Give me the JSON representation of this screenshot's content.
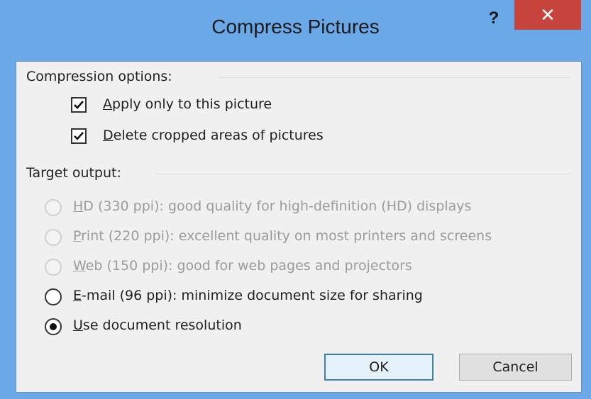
{
  "window": {
    "title": "Compress Pictures",
    "help_label": "?",
    "close_label": "✕"
  },
  "compression": {
    "group_title": "Compression options:",
    "checkboxes": [
      {
        "label": "Apply only to this picture",
        "accel": "A",
        "checked": true
      },
      {
        "label": "Delete cropped areas of pictures",
        "accel": "D",
        "checked": true
      }
    ]
  },
  "target": {
    "group_title": "Target output:",
    "options": [
      {
        "accel": "H",
        "rest": "D (330 ppi): good quality for high-definition (HD) displays",
        "enabled": false,
        "selected": false
      },
      {
        "accel": "P",
        "rest": "rint (220 ppi): excellent quality on most printers and screens",
        "enabled": false,
        "selected": false
      },
      {
        "accel": "W",
        "rest": "eb (150 ppi): good for web pages and projectors",
        "enabled": false,
        "selected": false
      },
      {
        "accel": "E",
        "rest": "-mail (96 ppi): minimize document size for sharing",
        "enabled": true,
        "selected": false
      },
      {
        "accel": "U",
        "rest": "se document resolution",
        "enabled": true,
        "selected": true
      }
    ]
  },
  "buttons": {
    "ok": "OK",
    "cancel": "Cancel"
  },
  "colors": {
    "title_bar": "#6aa8e8",
    "close_button": "#c7443c",
    "client_bg": "#f0f0f0"
  }
}
